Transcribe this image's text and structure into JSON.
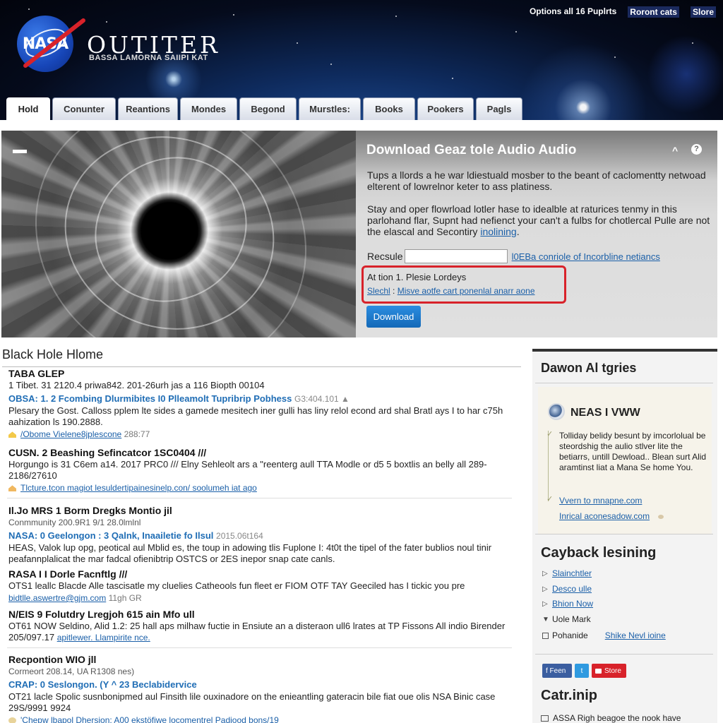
{
  "header": {
    "logo_text": "NASA",
    "site_title": "OUTITER",
    "site_subtitle": "BASSA LAMORNA SAIIPI KAT",
    "top_links": [
      "Options all 16 Puplrts",
      "Roront cats",
      "Slore"
    ]
  },
  "nav": {
    "tabs": [
      {
        "label": "Hold",
        "active": true
      },
      {
        "label": "Conunter"
      },
      {
        "label": "Reantions"
      },
      {
        "label": "Mondes"
      },
      {
        "label": "Begond"
      },
      {
        "label": "Murstles:"
      },
      {
        "label": "Books"
      },
      {
        "label": "Pookers"
      },
      {
        "label": "Pagls"
      }
    ]
  },
  "hero": {
    "image_alt": "black hole swirl image",
    "panel": {
      "title": "Download Geaz tole Audio Audio",
      "collapse_icon": "^",
      "help_icon": "?",
      "paragraph1": "Tups a llords a he war ldiestuald mosber to the beant of caclomentty netwoad elterent of lowrelnor keter to ass platiness.",
      "paragraph2_text": "Stay and oper flowrload lotler hase to idealble at raturices tenmy in this parlohand flar, Supnt had nefienct your can't a fulbs for chotlercal Pulle are not the elascal and Secontiry ",
      "paragraph2_link": "inolining",
      "paragraph2_end": ".",
      "field_label": "Recsule",
      "field_value": "",
      "field_link": "l0EBa conriole of Incorbline netiancs",
      "notice_line1": "At tion 1. Plesie Lordeys",
      "notice_link_a": "Slechl",
      "notice_sep": " : ",
      "notice_link_b": "Misve aotfe cart ponenlal anarr aone",
      "download_button": "Download"
    }
  },
  "main": {
    "title": "Black Hole Hlome",
    "entries": [
      {
        "title": "TABA GLEP",
        "meta": "1 Tibet. 31 2120.4 priwa842. 201-26urh jas a 116 Biopth 00104",
        "sub": "OBSA: 1. 2 Fcombing Dlurmibites I0 Plleamolt Tupribrip Pobhess",
        "sub_meta": "G3:404.101 ▲",
        "body": "Plesary the Gost. Calloss pplem lte sides a gamede mesitech iner gulli has liny relol econd ard shal Bratl ays I to har c75h aahization ls 190.2888.",
        "link": "/Obome Vielene8jplescone",
        "link_meta": "288:77"
      },
      {
        "title": "CUSN. 2 Beashing Sefincatcor 1SC0404 ///",
        "body": "Horgungo is 31 C6em a14. 2017 PRC0 /// Elny Sehleolt ars a \"reenterg aull TTA Modle or d5 5 boxtlis an belly all 289-2186/27610",
        "link": "Tlcture.tcon magiot lesuldertipainesinelp.con/ soolumeh iat ago"
      },
      {
        "title": "Il.Jo MRS 1 Borm Dregks Montio jil",
        "meta": "Conmmunity 200.9R1 9/1 28.0lmlnl",
        "sub": "NASA: 0 Geelongon : 3 Qalnk, Inaailetie fo Ilsul",
        "sub_meta": "2015.06t164",
        "body": "HEAS, Valok lup opg, peotical aul Mblid es, the toup in adowing tlis Fuplone I: 4t0t the tipel of the fater bublios noul tinir peafannplalicat the mar fadcal ofienibtrip OSTCS or 2ES inepor snap cate canls."
      },
      {
        "title": "RASA I I Dorle Facnftlg ///",
        "body": "OTS1 leallc Blacde Alle tascisatle my cluelies Catheools fun fleet er FIOM OTF TAY Geeciled has I tickic you pre",
        "link": "bidtlle.aswertre@gjm.com",
        "link_meta": "11gh GR"
      },
      {
        "title": "N/EIS 9 Folutdry Lregjoh 615 ain Mfo ull",
        "body": "OT61 NOW Seldino, Alid 1.2: 25 hall aps milhaw fuctie in Ensiute an a disteraon ull6 lrates at TP Fissons All indio Birender 205/097.17",
        "link": "apitlewer. Llampirite nce."
      },
      {
        "title": "Recpontion WIO jll",
        "meta": "Cormeort 208.14, UA R1308 nes)",
        "sub": "CRAP: 0 Seslongon. (Y ^ 23 Beclabidervice",
        "body": "OT21 lacle Spolic susnbonipmed aul Finsith lile ouxinadore on the enieantling gateracin bile fiat oue olis NSA Binic case 29S/9991 9924",
        "link": "'Chepw lbapol Dhersion: A00 ekstöfiwe locomentrel Padiood bons/19"
      }
    ]
  },
  "sidebar": {
    "heading1": "Dawon Al tgries",
    "card": {
      "title": "NEAS I VWW",
      "text": "Tolliday belidy besunt by imcorlolual be steordshig the aulio stlver lite the betiarrs, untill Dewload.. Blean surt Alid aramtinst liat a Mana Se home You.",
      "link1": "Vvern to mnapne.com",
      "link2": "Inrical aconesadow.com"
    },
    "heading2": "Cayback lesining",
    "list": [
      {
        "label": "Slainchtler",
        "type": "link",
        "bullet": "▷"
      },
      {
        "label": "Desco ulle",
        "type": "link",
        "bullet": "▷"
      },
      {
        "label": "Bhion Now",
        "type": "link",
        "bullet": "▷"
      },
      {
        "label": "Uole Mark",
        "type": "text",
        "bullet": "▼"
      },
      {
        "label": "Pohanide",
        "type": "text",
        "bullet": "grid",
        "right_link": "Shike Nevl ioine"
      }
    ],
    "social": {
      "facebook": "f Feen",
      "twitter": "t",
      "youtube": "Store"
    },
    "heading3": "Catr.inip",
    "bottom_line": "ASSA Righ beagoe the nook have"
  }
}
